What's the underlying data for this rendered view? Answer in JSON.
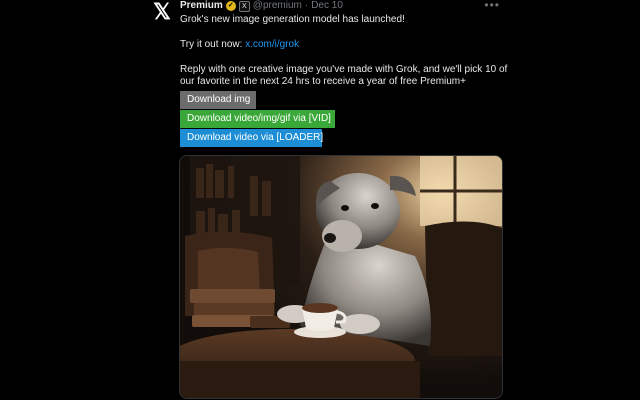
{
  "header": {
    "name": "Premium",
    "affiliate_badge": "X",
    "handle": "@premium",
    "separator": "·",
    "date": "Dec 10",
    "more": "•••"
  },
  "tweet": {
    "line1": "Grok's new image generation model has launched!",
    "try_label": "Try it out now: ",
    "try_link": "x.com/i/grok",
    "body1": "Reply with one creative image you've made with Grok, and we'll pick 10 of",
    "body2": "our favorite in the next 24 hrs to receive a year of free Premium+"
  },
  "buttons": {
    "download_img": "Download img",
    "download_video_gif": "Download video/img/gif via [VID]",
    "download_video_loader": "Download video via [LOADER]"
  },
  "icons": {
    "logo": "x-logo-icon",
    "verified": "gold-check-icon",
    "more": "more-options-icon"
  },
  "colors": {
    "background": "#000000",
    "link": "#1d9bf0",
    "btn_img": "#6c6c6c",
    "btn_vid": "#3aa839",
    "btn_loader": "#1d8ed6"
  }
}
